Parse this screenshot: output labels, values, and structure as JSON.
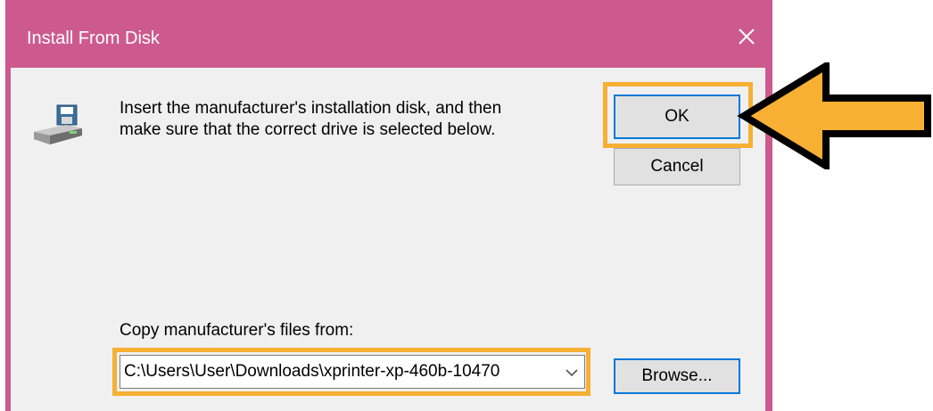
{
  "dialog": {
    "title": "Install From Disk",
    "close_icon": "close-icon",
    "message_line1": "Insert the manufacturer's installation disk, and then",
    "message_line2": "make sure that the correct drive is selected below.",
    "ok_label": "OK",
    "cancel_label": "Cancel",
    "copy_label": "Copy manufacturer's files from:",
    "path_value": "C:\\Users\\User\\Downloads\\xprinter-xp-460b-10470",
    "browse_label": "Browse...",
    "disk_icon": "disk-drive-icon"
  },
  "annotations": {
    "arrow_icon": "arrow-left-icon",
    "highlight_color": "#f7b033"
  },
  "colors": {
    "titlebar": "#cd5a8e",
    "dialog_bg": "#f0f0f0",
    "button_bg": "#e1e1e1",
    "focus_border": "#0078d7"
  }
}
